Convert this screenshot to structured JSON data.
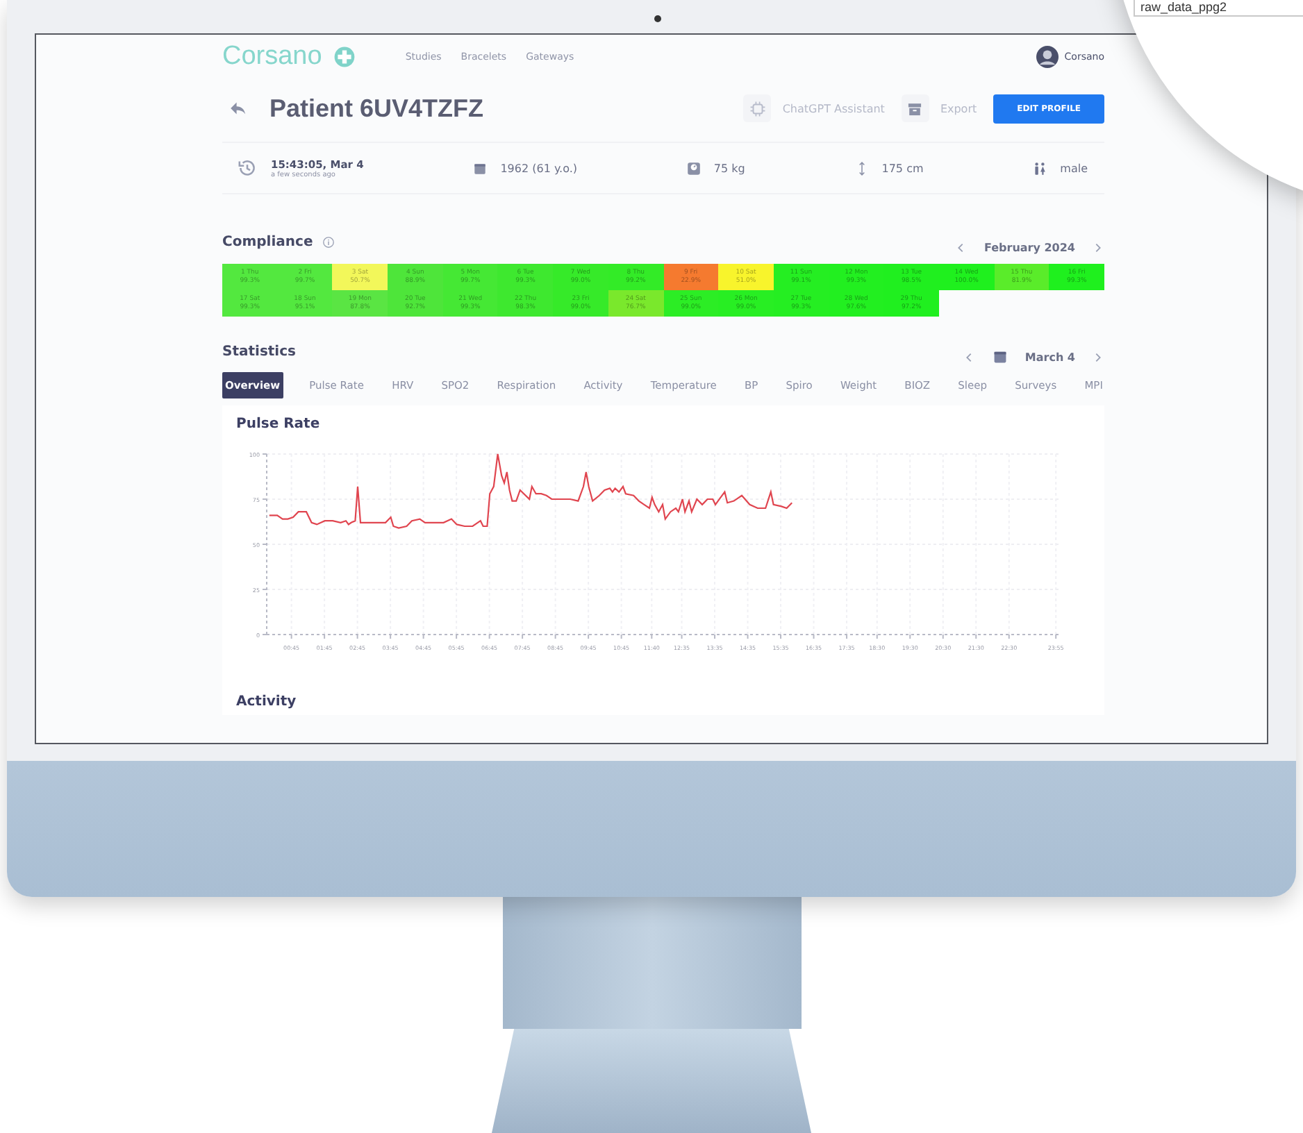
{
  "nav": {
    "brand": "Corsano",
    "links": [
      "Studies",
      "Bracelets",
      "Gateways"
    ],
    "user": "Corsano"
  },
  "zoom_bubble": {
    "field_value": "raw_data_ppg2"
  },
  "patient": {
    "title": "Patient 6UV4TZFZ",
    "actions": [
      {
        "kind": "ghost",
        "label": "ChatGPT Assistant"
      },
      {
        "kind": "ghost",
        "label": "Export"
      },
      {
        "kind": "primary",
        "label": "EDIT PROFILE"
      }
    ]
  },
  "info": [
    {
      "kind": "time",
      "value": "15:43:05, Mar 4",
      "sub": "a few seconds ago"
    },
    {
      "kind": "birth",
      "value": "1962 (61 y.o.)"
    },
    {
      "kind": "weight",
      "value": "75 kg"
    },
    {
      "kind": "height",
      "value": "175 cm"
    },
    {
      "kind": "sex",
      "value": "male"
    }
  ],
  "compliance": {
    "title": "Compliance",
    "month": "February 2024",
    "days": [
      {
        "label": "1 Thu",
        "value": "99.3%",
        "color": "#53e83f"
      },
      {
        "label": "2 Fri",
        "value": "99.7%",
        "color": "#53e83f"
      },
      {
        "label": "3 Sat",
        "value": "50.7%",
        "color": "#f2f75a"
      },
      {
        "label": "4 Sun",
        "value": "88.9%",
        "color": "#4ee53a"
      },
      {
        "label": "5 Mon",
        "value": "99.7%",
        "color": "#45e834"
      },
      {
        "label": "6 Tue",
        "value": "99.3%",
        "color": "#3ee82f"
      },
      {
        "label": "7 Wed",
        "value": "99.0%",
        "color": "#36ea29"
      },
      {
        "label": "8 Thu",
        "value": "99.2%",
        "color": "#33eb27"
      },
      {
        "label": "9 Fri",
        "value": "22.9%",
        "color": "#f57a2f"
      },
      {
        "label": "10 Sat",
        "value": "51.0%",
        "color": "#f8f42c"
      },
      {
        "label": "11 Sun",
        "value": "99.1%",
        "color": "#25ee22"
      },
      {
        "label": "12 Mon",
        "value": "99.3%",
        "color": "#22ef20"
      },
      {
        "label": "13 Tue",
        "value": "98.5%",
        "color": "#20ef1f"
      },
      {
        "label": "14 Wed",
        "value": "100.0%",
        "color": "#1ff01e"
      },
      {
        "label": "15 Thu",
        "value": "81.9%",
        "color": "#5aec2a"
      },
      {
        "label": "16 Fri",
        "value": "99.3%",
        "color": "#1ff01e"
      },
      {
        "label": "17 Sat",
        "value": "99.3%",
        "color": "#53e83f"
      },
      {
        "label": "18 Sun",
        "value": "95.1%",
        "color": "#53e83f"
      },
      {
        "label": "19 Mon",
        "value": "87.8%",
        "color": "#5ae543"
      },
      {
        "label": "20 Tue",
        "value": "92.7%",
        "color": "#4ee53a"
      },
      {
        "label": "21 Wed",
        "value": "99.3%",
        "color": "#45e834"
      },
      {
        "label": "22 Thu",
        "value": "98.3%",
        "color": "#3ee82f"
      },
      {
        "label": "23 Fri",
        "value": "99.0%",
        "color": "#36ea29"
      },
      {
        "label": "24 Sat",
        "value": "76.7%",
        "color": "#7ae82c"
      },
      {
        "label": "25 Sun",
        "value": "99.0%",
        "color": "#2ced25"
      },
      {
        "label": "26 Mon",
        "value": "99.0%",
        "color": "#28ee23"
      },
      {
        "label": "27 Tue",
        "value": "99.3%",
        "color": "#25ee22"
      },
      {
        "label": "28 Wed",
        "value": "97.6%",
        "color": "#22ef20"
      },
      {
        "label": "29 Thu",
        "value": "97.2%",
        "color": "#20ef1f"
      }
    ]
  },
  "statistics": {
    "title": "Statistics",
    "date": "March 4",
    "tabs": [
      {
        "label": "Overview",
        "selected": true
      },
      {
        "label": "Pulse Rate",
        "selected": false
      },
      {
        "label": "HRV",
        "selected": false
      },
      {
        "label": "SPO2",
        "selected": false
      },
      {
        "label": "Respiration",
        "selected": false
      },
      {
        "label": "Activity",
        "selected": false
      },
      {
        "label": "Temperature",
        "selected": false
      },
      {
        "label": "BP",
        "selected": false
      },
      {
        "label": "Spiro",
        "selected": false
      },
      {
        "label": "Weight",
        "selected": false
      },
      {
        "label": "BIOZ",
        "selected": false
      },
      {
        "label": "Sleep",
        "selected": false
      },
      {
        "label": "Surveys",
        "selected": false
      },
      {
        "label": "MPI",
        "selected": false
      }
    ]
  },
  "pulse_rate": {
    "title": "Pulse Rate",
    "chart_data": {
      "type": "line",
      "grid": true,
      "xlim": [
        0,
        24
      ],
      "ylim": [
        0,
        100
      ],
      "yticks": [
        0,
        25,
        50,
        75,
        100
      ],
      "xticks": [
        {
          "value": 0.75,
          "label": "00:45"
        },
        {
          "value": 1.75,
          "label": "01:45"
        },
        {
          "value": 2.75,
          "label": "02:45"
        },
        {
          "value": 3.75,
          "label": "03:45"
        },
        {
          "value": 4.75,
          "label": "04:45"
        },
        {
          "value": 5.75,
          "label": "05:45"
        },
        {
          "value": 6.75,
          "label": "06:45"
        },
        {
          "value": 7.75,
          "label": "07:45"
        },
        {
          "value": 8.75,
          "label": "08:45"
        },
        {
          "value": 9.75,
          "label": "09:45"
        },
        {
          "value": 10.75,
          "label": "10:45"
        },
        {
          "value": 11.67,
          "label": "11:40"
        },
        {
          "value": 12.58,
          "label": "12:35"
        },
        {
          "value": 13.58,
          "label": "13:35"
        },
        {
          "value": 14.58,
          "label": "14:35"
        },
        {
          "value": 15.58,
          "label": "15:35"
        },
        {
          "value": 16.58,
          "label": "16:35"
        },
        {
          "value": 17.58,
          "label": "17:35"
        },
        {
          "value": 18.5,
          "label": "18:30"
        },
        {
          "value": 19.5,
          "label": "19:30"
        },
        {
          "value": 20.5,
          "label": "20:30"
        },
        {
          "value": 21.5,
          "label": "21:30"
        },
        {
          "value": 22.5,
          "label": "22:30"
        },
        {
          "value": 23.92,
          "label": "23:55"
        }
      ],
      "x": [
        0.08,
        0.32,
        0.48,
        0.64,
        0.8,
        0.96,
        1.2,
        1.36,
        1.52,
        1.76,
        2.0,
        2.24,
        2.4,
        2.48,
        2.56,
        2.68,
        2.76,
        2.84,
        3.04,
        3.36,
        3.6,
        3.76,
        3.84,
        4.0,
        4.24,
        4.4,
        4.64,
        4.8,
        5.12,
        5.36,
        5.6,
        5.76,
        6.0,
        6.24,
        6.48,
        6.56,
        6.68,
        6.76,
        6.88,
        7.0,
        7.12,
        7.2,
        7.28,
        7.36,
        7.44,
        7.56,
        7.68,
        7.96,
        8.04,
        8.16,
        8.32,
        8.48,
        8.64,
        8.8,
        9.04,
        9.2,
        9.44,
        9.6,
        9.68,
        9.76,
        9.88,
        10.08,
        10.24,
        10.4,
        10.48,
        10.56,
        10.68,
        10.8,
        10.88,
        11.12,
        11.28,
        11.44,
        11.6,
        11.68,
        11.76,
        11.88,
        12.0,
        12.08,
        12.24,
        12.4,
        12.48,
        12.6,
        12.68,
        12.8,
        12.88,
        13.04,
        13.2,
        13.36,
        13.52,
        13.6,
        13.76,
        13.88,
        13.96,
        14.16,
        14.4,
        14.64,
        14.88,
        15.12,
        15.28,
        15.36,
        15.6,
        15.76,
        15.92
      ],
      "series": [
        {
          "color": "#e0454f",
          "values": [
            66,
            66,
            64,
            64,
            65,
            68,
            68,
            62,
            61,
            63,
            63,
            62,
            63,
            61,
            62,
            63,
            82,
            62,
            62,
            62,
            62,
            65,
            60,
            59,
            60,
            63,
            64,
            62,
            62,
            62,
            64,
            61,
            60,
            60,
            63,
            60,
            60,
            78,
            82,
            100,
            88,
            84,
            90,
            80,
            74,
            74,
            80,
            75,
            82,
            78,
            78,
            77,
            75,
            75,
            75,
            75,
            74,
            82,
            90,
            82,
            74,
            77,
            80,
            81,
            79,
            81,
            79,
            82,
            78,
            77,
            74,
            72,
            70,
            76,
            72,
            68,
            72,
            64,
            68,
            70,
            68,
            75,
            68,
            74,
            68,
            75,
            72,
            75,
            75,
            72,
            76,
            79,
            73,
            74,
            77,
            72,
            70,
            70,
            79,
            72,
            71,
            70,
            73
          ]
        }
      ]
    }
  },
  "activity": {
    "title": "Activity"
  }
}
